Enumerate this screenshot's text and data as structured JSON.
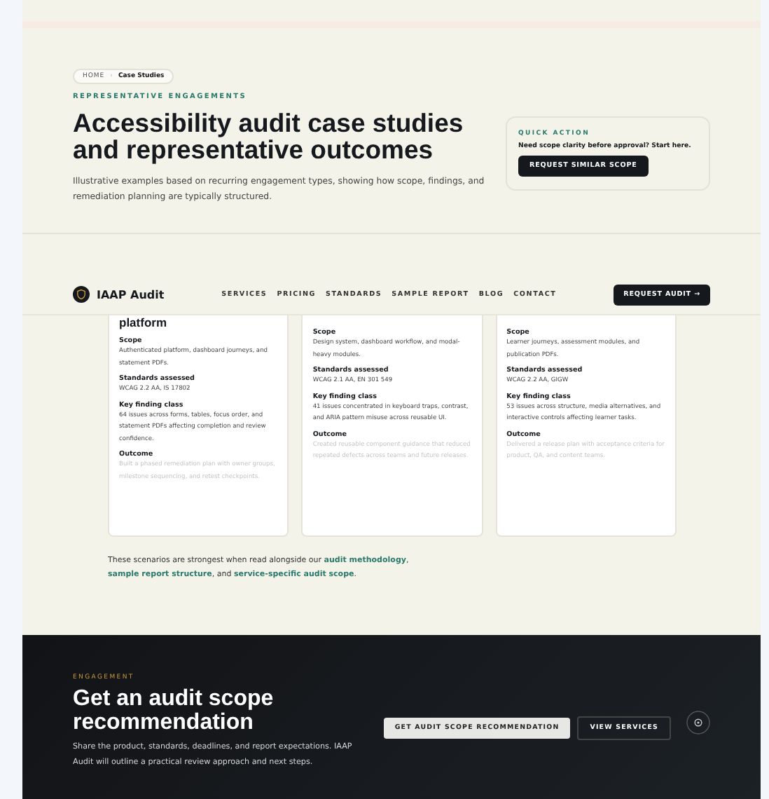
{
  "breadcrumb_separator": "›",
  "breadcrumb": [
    {
      "label": "HOME",
      "selected": false
    },
    {
      "label": "Case Studies",
      "selected": true
    }
  ],
  "hero": {
    "eyebrow": "REPRESENTATIVE ENGAGEMENTS",
    "title": "Accessibility audit case studies and representative outcomes",
    "intro": "Illustrative examples based on recurring engagement types, showing how scope, findings, and remediation planning are typically structured."
  },
  "quick_action": {
    "label": "QUICK ACTION",
    "text": "Need scope clarity before approval? Start here.",
    "button": "REQUEST SIMILAR SCOPE"
  },
  "nav": {
    "brand": "IAAP Audit",
    "links": [
      "SERVICES",
      "PRICING",
      "STANDARDS",
      "SAMPLE REPORT",
      "BLOG",
      "CONTACT"
    ],
    "cta": "REQUEST AUDIT",
    "cta_icon": "→"
  },
  "cards": [
    {
      "title": "platform",
      "sections": [
        {
          "heading": "Scope",
          "text": "Authenticated platform, dashboard journeys, and statement PDFs.",
          "muted": false
        },
        {
          "heading": "Standards assessed",
          "text": "WCAG 2.2 AA, IS 17802",
          "muted": false
        },
        {
          "heading": "Key finding class",
          "text": "64 issues across forms, tables, focus order, and statement PDFs affecting completion and review confidence.",
          "muted": false
        },
        {
          "heading": "Outcome",
          "text": "Built a phased remediation plan with owner groups, milestone sequencing, and retest checkpoints.",
          "muted": true
        }
      ]
    },
    {
      "sections": [
        {
          "heading": "Scope",
          "text": "Design system, dashboard workflow, and modal-heavy modules.",
          "muted": false
        },
        {
          "heading": "Standards assessed",
          "text": "WCAG 2.1 AA, EN 301 549",
          "muted": false
        },
        {
          "heading": "Key finding class",
          "text": "41 issues concentrated in keyboard traps, contrast, and ARIA pattern misuse across reusable UI.",
          "muted": false
        },
        {
          "heading": "Outcome",
          "text": "Created reusable component guidance that reduced repeated defects across teams and future releases.",
          "muted": true
        }
      ]
    },
    {
      "sections": [
        {
          "heading": "Scope",
          "text": "Learner journeys, assessment modules, and publication PDFs.",
          "muted": false
        },
        {
          "heading": "Standards assessed",
          "text": "WCAG 2.2 AA, GIGW",
          "muted": false
        },
        {
          "heading": "Key finding class",
          "text": "53 issues across structure, media alternatives, and interactive controls affecting learner tasks.",
          "muted": false
        },
        {
          "heading": "Outcome",
          "text": "Delivered a release plan with acceptance criteria for product, QA, and content teams.",
          "muted": true
        }
      ]
    }
  ],
  "note": {
    "parts": [
      {
        "kind": "text",
        "text": "These scenarios are strongest when read alongside our "
      },
      {
        "kind": "link",
        "text": "audit methodology"
      },
      {
        "kind": "text",
        "text": ", "
      },
      {
        "kind": "link",
        "text": "sample report structure"
      },
      {
        "kind": "text",
        "text": ", and "
      },
      {
        "kind": "link",
        "text": "service-specific audit scope"
      },
      {
        "kind": "text",
        "text": "."
      }
    ]
  },
  "cta_section": {
    "eyebrow": "ENGAGEMENT",
    "title": "Get an audit scope recommendation",
    "text": "Share the product, standards, deadlines, and report expectations. IAAP Audit will outline a practical review approach and next steps.",
    "buttons": [
      {
        "label": "GET AUDIT SCOPE RECOMMENDATION",
        "kind": "primary"
      },
      {
        "label": "VIEW SERVICES",
        "kind": "outline"
      }
    ]
  }
}
